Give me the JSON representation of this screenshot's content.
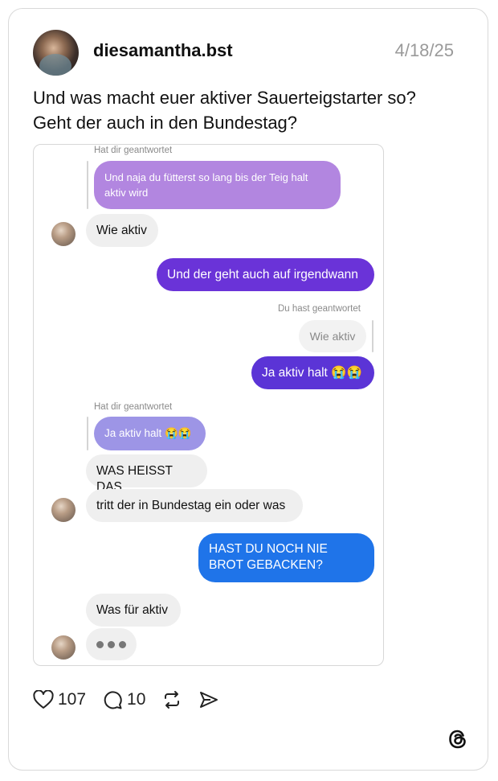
{
  "post": {
    "username": "diesamantha.bst",
    "date": "4/18/25",
    "caption_lines": [
      "Und was macht euer aktiver Sauerteigstarter so?",
      "Geht der auch in den Bundestag?"
    ]
  },
  "chat": {
    "reply_note_1": "Hat dir geantwortet",
    "quote_1": "Und naja du fütterst so lang bis der Teig halt aktiv wird",
    "msg_1": "Wie aktiv",
    "msg_2": "Und der geht auch auf irgendwann",
    "reply_note_2": "Du hast geantwortet",
    "quote_2": "Wie aktiv",
    "msg_3": "Ja aktiv halt 😭😭",
    "reply_note_3": "Hat dir geantwortet",
    "quote_3": "Ja aktiv halt 😭😭",
    "msg_4": "WAS HEISST DAS",
    "msg_5": "tritt der in Bundestag ein oder was",
    "msg_6": "HAST DU NOCH NIE BROT GEBACKEN?",
    "msg_7": "Was für aktiv"
  },
  "actions": {
    "likes": "107",
    "comments": "10",
    "icons": [
      "heart-icon",
      "comment-icon",
      "repost-icon",
      "share-icon",
      "threads-logo-icon"
    ]
  },
  "colors": {
    "purple": "#6a33d8",
    "indigo": "#5b34d6",
    "blue": "#1f74e9",
    "incoming": "#efefef"
  }
}
